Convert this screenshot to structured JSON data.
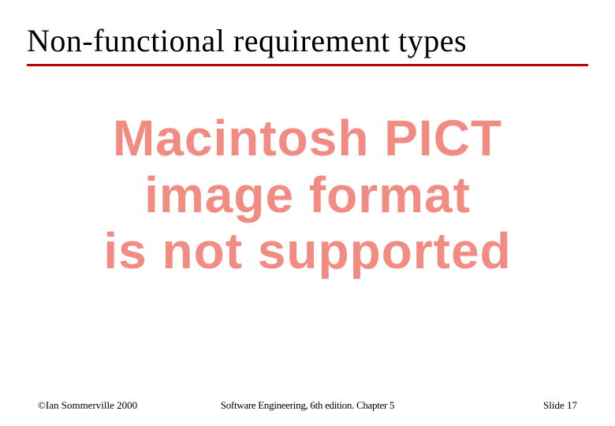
{
  "title": "Non-functional requirement types",
  "error_line1": "Macintosh PICT",
  "error_line2": "image format",
  "error_line3": "is not supported",
  "footer": {
    "copyright": "©Ian Sommerville 2000",
    "center": "Software Engineering, 6th edition. Chapter 5",
    "slide_label": "Slide  17"
  }
}
